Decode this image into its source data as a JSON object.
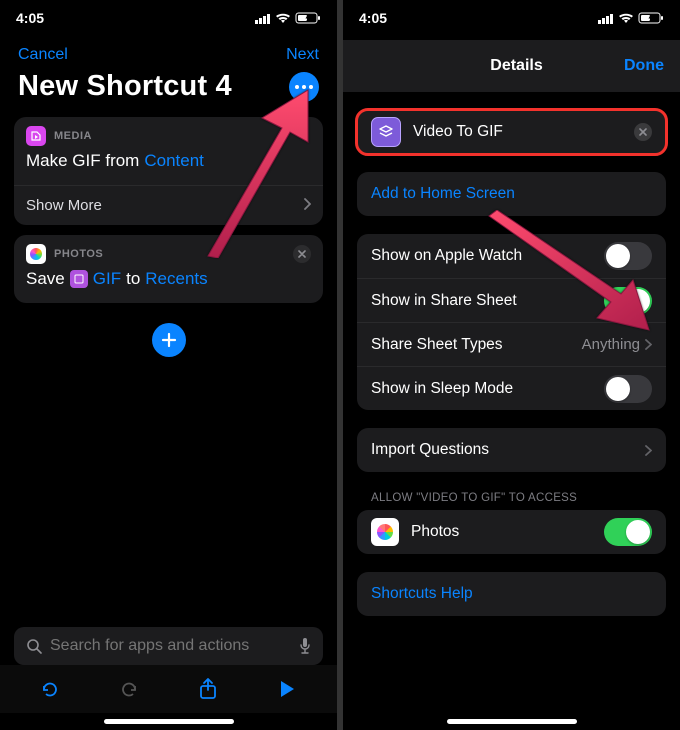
{
  "status": {
    "time": "4:05"
  },
  "left": {
    "cancel": "Cancel",
    "next": "Next",
    "title": "New Shortcut 4",
    "card1": {
      "category": "MEDIA",
      "line_pre": "Make GIF from",
      "line_token": "Content",
      "footer": "Show More"
    },
    "card2": {
      "category": "PHOTOS",
      "w1": "Save",
      "w2": "GIF",
      "w3": "to",
      "w4": "Recents"
    },
    "search_placeholder": "Search for apps and actions"
  },
  "right": {
    "header_title": "Details",
    "done": "Done",
    "shortcut_name": "Video To GIF",
    "add_home": "Add to Home Screen",
    "rows": {
      "watch": "Show on Apple Watch",
      "share": "Show in Share Sheet",
      "types": "Share Sheet Types",
      "types_value": "Anything",
      "sleep": "Show in Sleep Mode",
      "import": "Import Questions",
      "access_label": "ALLOW \"VIDEO TO GIF\" TO ACCESS",
      "photos": "Photos",
      "help": "Shortcuts Help"
    },
    "toggles": {
      "watch": false,
      "share": true,
      "sleep": false,
      "photos": true
    }
  }
}
